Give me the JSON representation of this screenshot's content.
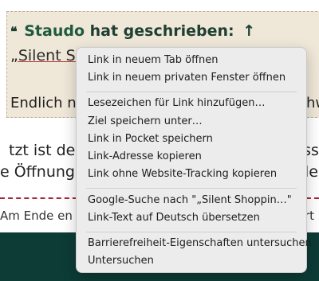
{
  "page": {
    "quote_header": {
      "quote_mark": "❝",
      "author": "Staudo",
      "wrote": "hat geschrieben:",
      "arrow": "↑"
    },
    "quote_link_text": "„Silent Shoppin…",
    "quote_text_left": "Endlich n",
    "quote_text_right": "hw",
    "body_line_1_left": "tzt ist der",
    "body_line_1_right": "ss",
    "body_line_2_left": "e Öffnung",
    "body_line_2_right": "le",
    "footer_left": "Am Ende en",
    "footer_right": "rt"
  },
  "context_menu": {
    "items": [
      "Link in neuem Tab öffnen",
      "Link in neuem privaten Fenster öffnen",
      "Lesezeichen für Link hinzufügen…",
      "Ziel speichern unter…",
      "Link in Pocket speichern",
      "Link-Adresse kopieren",
      "Link ohne Website-Tracking kopieren",
      "Google-Suche nach \"„Silent Shoppin…\"",
      "Link-Text auf Deutsch übersetzen",
      "Barrierefreiheit-Eigenschaften untersuchen",
      "Untersuchen"
    ]
  },
  "colors": {
    "quote_bg": "#efe7d8",
    "accent_red": "#a8223a",
    "dark_band": "#0d3b36",
    "menu_bg": "#ececec"
  }
}
